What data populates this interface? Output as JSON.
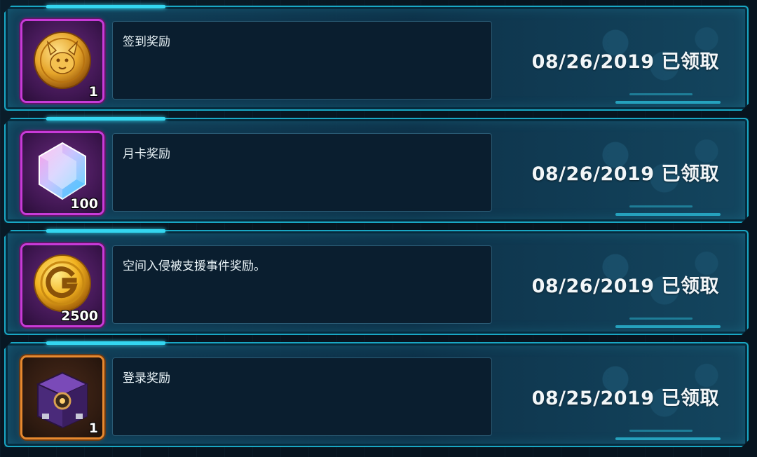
{
  "rewards": [
    {
      "title": "签到奖励",
      "item_icon": "gold-medal-icon",
      "quantity": "1",
      "frame_color": "#c83ad8",
      "date": "08/26/2019",
      "status": "已领取"
    },
    {
      "title": "月卡奖励",
      "item_icon": "diamond-gem-icon",
      "quantity": "100",
      "frame_color": "#c83ad8",
      "date": "08/26/2019",
      "status": "已领取"
    },
    {
      "title": "空间入侵被支援事件奖励。",
      "item_icon": "gold-coin-g-icon",
      "quantity": "2500",
      "frame_color": "#c83ad8",
      "date": "08/26/2019",
      "status": "已领取"
    },
    {
      "title": "登录奖励",
      "item_icon": "purple-treasure-chest-icon",
      "quantity": "1",
      "frame_color": "#e7892f",
      "date": "08/25/2019",
      "status": "已领取"
    }
  ],
  "colors": {
    "frame_cyan": "#19a7c4",
    "text_primary": "#f2f6f8"
  }
}
